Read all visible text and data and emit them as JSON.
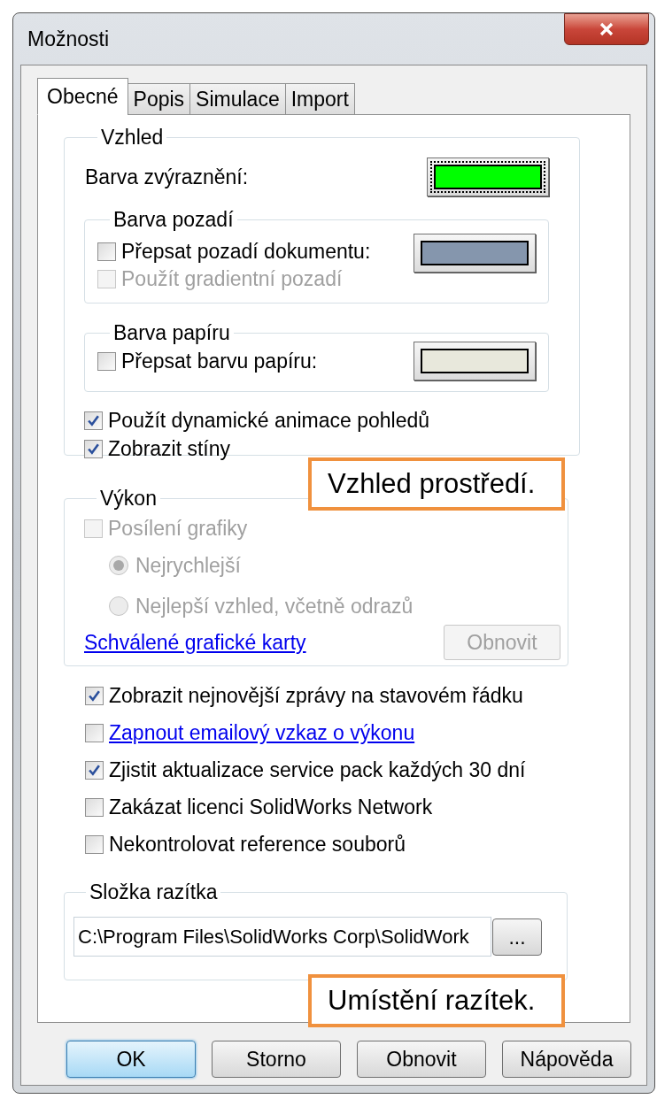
{
  "window": {
    "title": "Možnosti"
  },
  "tabs": [
    {
      "label": "Obecné",
      "selected": true
    },
    {
      "label": "Popis",
      "selected": false
    },
    {
      "label": "Simulace",
      "selected": false
    },
    {
      "label": "Import",
      "selected": false
    }
  ],
  "appearance": {
    "title": "Vzhled",
    "highlight": {
      "label": "Barva zvýraznění:",
      "color": "#00ff00",
      "focused": true
    },
    "background": {
      "title": "Barva pozadí",
      "color": "#8596ad",
      "options": [
        {
          "label": "Přepsat pozadí dokumentu:",
          "checked": false,
          "disabled": false
        },
        {
          "label": "Použít gradientní pozadí",
          "checked": false,
          "disabled": true
        }
      ]
    },
    "paper": {
      "title": "Barva papíru",
      "color": "#e8e8dc",
      "options": [
        {
          "label": "Přepsat barvu papíru:",
          "checked": false,
          "disabled": false
        }
      ]
    },
    "options": [
      {
        "label": "Použít dynamické animace pohledů",
        "checked": true
      },
      {
        "label": "Zobrazit stíny",
        "checked": true
      }
    ]
  },
  "performance": {
    "title": "Výkon",
    "option": {
      "label": "Posílení grafiky",
      "checked": false,
      "disabled": true
    },
    "radios": [
      {
        "label": "Nejrychlejší",
        "selected": true,
        "disabled": true
      },
      {
        "label": "Nejlepší vzhled, včetně odrazů",
        "selected": false,
        "disabled": true
      }
    ],
    "link": "Schválené grafické karty",
    "button": {
      "label": "Obnovit",
      "disabled": true
    }
  },
  "general_options": [
    {
      "kind": "checkbox",
      "label": "Zobrazit nejnovější zprávy na stavovém řádku",
      "checked": true
    },
    {
      "kind": "link",
      "label": "Zapnout emailový vzkaz o výkonu",
      "checked": false
    },
    {
      "kind": "checkbox",
      "label": "Zjistit aktualizace service pack každých 30 dní",
      "checked": true
    },
    {
      "kind": "checkbox",
      "label": "Zakázat licenci SolidWorks Network",
      "checked": false
    },
    {
      "kind": "checkbox",
      "label": "Nekontrolovat reference souborů",
      "checked": false
    }
  ],
  "stamp_folder": {
    "title": "Složka razítka",
    "path": "C:\\Program Files\\SolidWorks Corp\\SolidWork",
    "browse": "..."
  },
  "buttons": [
    {
      "label": "OK",
      "default": true
    },
    {
      "label": "Storno",
      "default": false
    },
    {
      "label": "Obnovit",
      "default": false
    },
    {
      "label": "Nápověda",
      "default": false
    }
  ],
  "callouts": [
    {
      "text": "Vzhled prostředí."
    },
    {
      "text": "Umístění razítek."
    }
  ]
}
